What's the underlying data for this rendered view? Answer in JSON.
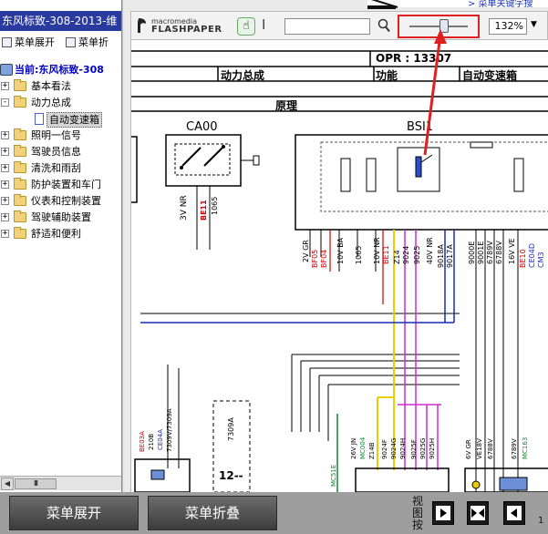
{
  "window": {
    "title": "东风标致-308-2013-维"
  },
  "left_toolbar": {
    "expand_label": "菜单展开",
    "collapse_label": "菜单折"
  },
  "tree": {
    "root_label": "当前:东风标致-308",
    "items": [
      {
        "label": "基本看法",
        "expander": "+"
      },
      {
        "label": "动力总成",
        "expander": "-"
      },
      {
        "label": "自动变速箱",
        "selected": true
      },
      {
        "label": "照明一信号",
        "expander": "+"
      },
      {
        "label": "驾驶员信息",
        "expander": "+"
      },
      {
        "label": "清洗和雨刮",
        "expander": "+"
      },
      {
        "label": "防护装置和车门",
        "expander": "+"
      },
      {
        "label": "仪表和控制装置",
        "expander": "+"
      },
      {
        "label": "驾驶辅助装置",
        "expander": "+"
      },
      {
        "label": "舒适和便利",
        "expander": "+"
      }
    ]
  },
  "scrollbar": {
    "left_arrow": "◀",
    "thumb_grip": "III"
  },
  "viewer": {
    "logo_line1": "macromedia",
    "logo_line2": "FLASHPAPER",
    "hand_tool": "☝",
    "select_tool": "I",
    "search_value": "",
    "zoom_level": "132%",
    "zoom_arrow": "▼",
    "banner_text": "> 菜单关键字搜"
  },
  "document": {
    "opr": "OPR : 13307",
    "col1": "动力总成",
    "col2": "功能",
    "col3": "自动变速箱",
    "subtitle": "原理",
    "component_left": "CA00",
    "component_right": "BSI1"
  },
  "bottom_bar": {
    "expand_button": "菜单展开",
    "collapse_button": "菜单折叠",
    "view_label": "视图按",
    "page_partial": "1"
  },
  "colors": {
    "title_bar": "#2a3b9f",
    "annotation_red": "#e02020",
    "tree_root_text": "#0000c0"
  }
}
